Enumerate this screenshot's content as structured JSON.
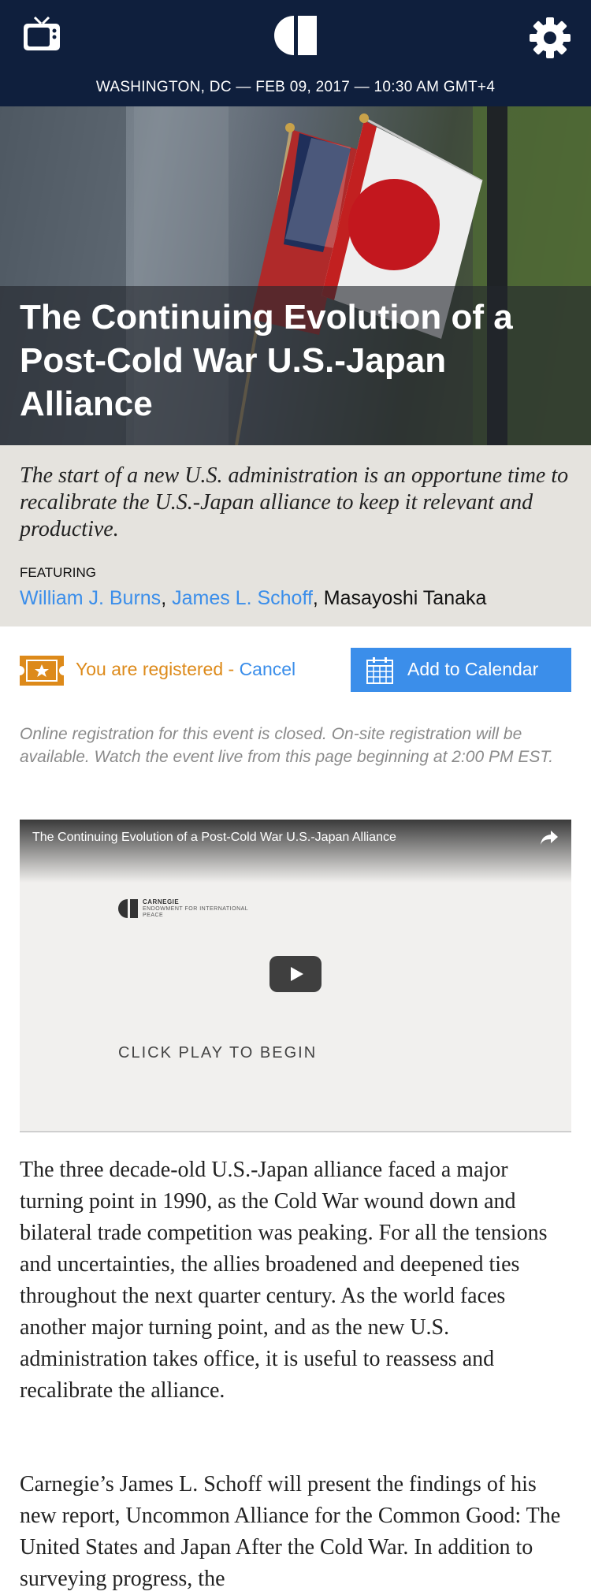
{
  "header": {
    "dateline": "WASHINGTON, DC — FEB 09, 2017 — 10:30 AM GMT+4"
  },
  "hero": {
    "title": "The Continuing Evolution of a Post-Cold War U.S.-Japan Alliance"
  },
  "summary": {
    "text": "The start of a new U.S. administration is an opportune time to recalibrate the U.S.-Japan alliance to keep it relevant and productive.",
    "featuring_label": "FEATURING",
    "speakers": [
      "William J. Burns",
      "James L. Schoff",
      "Masayoshi Tanaka"
    ]
  },
  "registration": {
    "status": "You are registered - ",
    "cancel": "Cancel",
    "calendar_button": "Add to Calendar"
  },
  "notice": "Online registration for this event is closed. On-site registration will be available. Watch the event live from this page beginning at 2:00 PM EST.",
  "video": {
    "title": "The Continuing Evolution of a Post-Cold War U.S.-Japan Alliance",
    "org_line1": "CARNEGIE",
    "org_line2": "ENDOWMENT FOR INTERNATIONAL PEACE",
    "click_play": "CLICK PLAY TO BEGIN"
  },
  "body": {
    "p1": "The three decade-old U.S.-Japan alliance faced a major turning point in 1990, as the Cold War wound down and bilateral trade competition was peaking. For all the tensions and uncertainties, the allies broadened and deepened ties throughout the next quarter century. As the world faces another major turning point, and as the new U.S. administration takes office, it is useful to reassess and recalibrate the alliance.",
    "p2": "Carnegie’s James L. Schoff will present the findings of his new report, Uncommon Alliance for the Common Good: The United States and Japan After the Cold War. In addition to surveying progress, the"
  },
  "colors": {
    "header_bg": "#0f1f3d",
    "link": "#3b8eea",
    "registered": "#dd8a1a",
    "summary_bg": "#e5e3de"
  }
}
